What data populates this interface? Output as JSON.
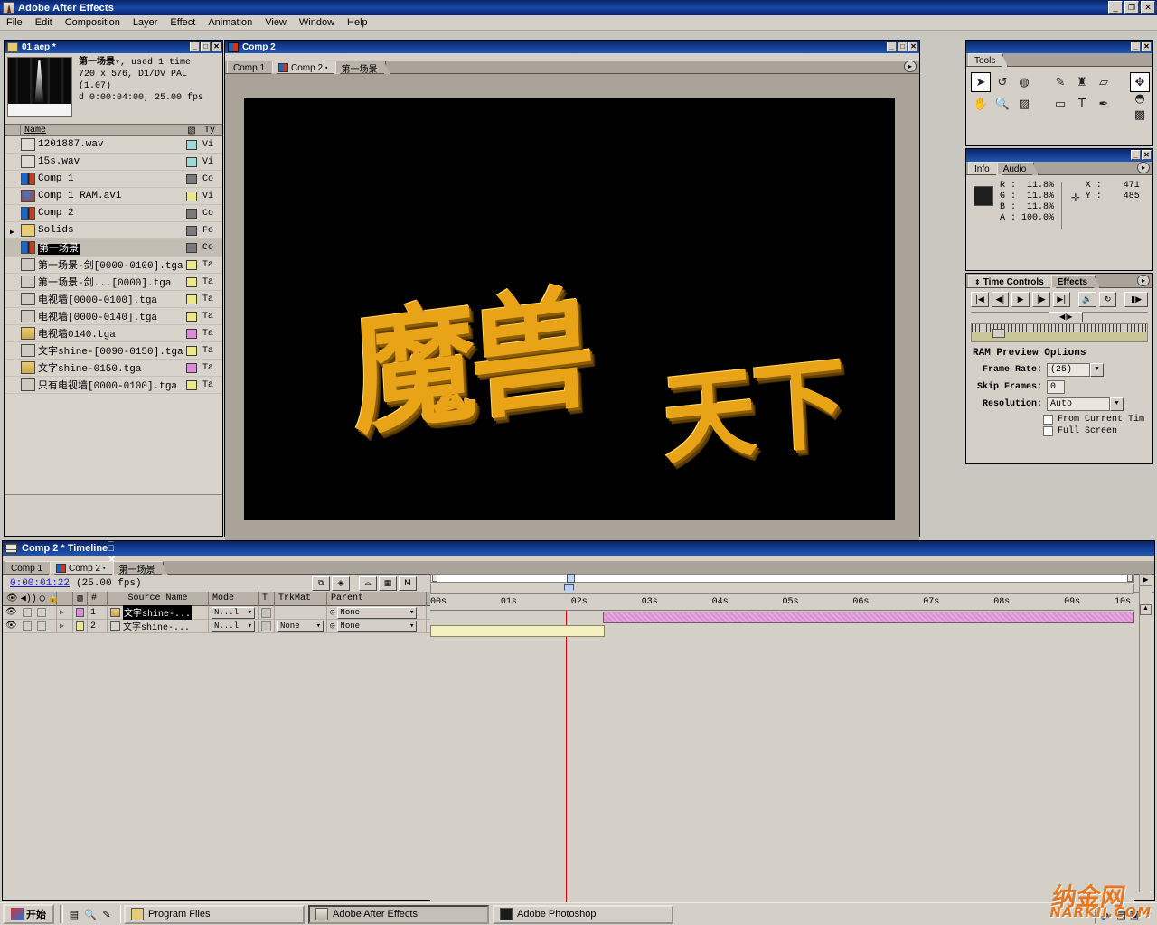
{
  "window": {
    "app_title": "Adobe After Effects",
    "minimize": "_",
    "restore": "❐",
    "close": "✕"
  },
  "menu": {
    "items": [
      "File",
      "Edit",
      "Composition",
      "Layer",
      "Effect",
      "Animation",
      "View",
      "Window",
      "Help"
    ]
  },
  "project": {
    "title": "01.aep *",
    "minimize": "_",
    "maximize": "□",
    "close": "✕",
    "preview": {
      "name": "第一场景",
      "dropdown": "▾",
      "used": ", used 1 time",
      "dimensions": "720 x 576, D1/DV PAL (1.07)",
      "duration": "d 0:00:04:00, 25.00 fps"
    },
    "columns": {
      "name": "Name",
      "type": "Ty"
    },
    "items": [
      {
        "name": "1201887.wav",
        "icon": "audio-icon",
        "swatch": "#9fd8d8",
        "type": "Vi"
      },
      {
        "name": "15s.wav",
        "icon": "audio-icon",
        "swatch": "#9fd8d8",
        "type": "Vi"
      },
      {
        "name": "Comp 1",
        "icon": "comp-icon",
        "swatch": "#7a7a7a",
        "type": "Co"
      },
      {
        "name": "Comp 1 RAM.avi",
        "icon": "movie-icon",
        "swatch": "#ece98a",
        "type": "Vi"
      },
      {
        "name": "Comp 2",
        "icon": "comp-icon",
        "swatch": "#7a7a7a",
        "type": "Co"
      },
      {
        "name": "Solids",
        "icon": "folder-icon",
        "swatch": "#7a7a7a",
        "type": "Fo",
        "expandable": true
      },
      {
        "name": "第一场景",
        "icon": "comp-icon",
        "swatch": "#7a7a7a",
        "type": "Co",
        "selected": true
      },
      {
        "name": "第一场景-剑[0000-0100].tga",
        "icon": "seq-icon",
        "swatch": "#ece98a",
        "type": "Ta"
      },
      {
        "name": "第一场景-剑...[0000].tga",
        "icon": "seq-icon",
        "swatch": "#ece98a",
        "type": "Ta"
      },
      {
        "name": "电视墙[0000-0100].tga",
        "icon": "seq-icon",
        "swatch": "#ece98a",
        "type": "Ta"
      },
      {
        "name": "电视墙[0000-0140].tga",
        "icon": "seq-icon",
        "swatch": "#ece98a",
        "type": "Ta"
      },
      {
        "name": "电视墙0140.tga",
        "icon": "still-icon",
        "swatch": "#dd8ad8",
        "type": "Ta"
      },
      {
        "name": "文字shine-[0090-0150].tga",
        "icon": "seq-icon",
        "swatch": "#ece98a",
        "type": "Ta"
      },
      {
        "name": "文字shine-0150.tga",
        "icon": "still-icon",
        "swatch": "#dd8ad8",
        "type": "Ta"
      },
      {
        "name": "只有电视墙[0000-0100].tga",
        "icon": "seq-icon",
        "swatch": "#ece98a",
        "type": "Ta"
      }
    ]
  },
  "comp_window": {
    "title": "Comp 2",
    "minimize": "_",
    "maximize": "□",
    "close": "✕",
    "tabs": [
      {
        "label": "Comp 1",
        "active": false
      },
      {
        "label": "Comp 2",
        "active": true
      },
      {
        "label": "第一场景",
        "active": false
      }
    ],
    "menu_arrow": "▸",
    "artwork": {
      "background": "#000000",
      "gold": "#e8a317",
      "text_left": "魔兽",
      "text_right": "天下"
    }
  },
  "tools": {
    "title": "Tools",
    "minimize": "_",
    "close": "✕",
    "items": [
      {
        "name": "selection-tool",
        "glyph": "➤",
        "active": true
      },
      {
        "name": "rotate-tool",
        "glyph": "↺",
        "active": false
      },
      {
        "name": "orbit-tool",
        "glyph": "◍",
        "active": false
      },
      {
        "name": "hand-tool",
        "glyph": "✋",
        "active": false
      },
      {
        "name": "zoom-tool",
        "glyph": "🔍",
        "active": false
      },
      {
        "name": "mask-tool",
        "glyph": "▨",
        "active": false
      },
      {
        "name": "brush-tool",
        "glyph": "✎",
        "active": false
      },
      {
        "name": "clone-stamp-tool",
        "glyph": "♜",
        "active": false
      },
      {
        "name": "eraser-tool",
        "glyph": "▱",
        "active": false
      },
      {
        "name": "shape-tool",
        "glyph": "▭",
        "active": false
      },
      {
        "name": "text-tool",
        "glyph": "T",
        "active": false
      },
      {
        "name": "pen-tool",
        "glyph": "✒",
        "active": false
      },
      {
        "name": "axis-tool",
        "glyph": "✥",
        "active": true
      },
      {
        "name": "light-tool",
        "glyph": "◓",
        "active": false
      },
      {
        "name": "camera-tool",
        "glyph": "▩",
        "active": false
      }
    ]
  },
  "info": {
    "minimize": "_",
    "close": "✕",
    "tabs": [
      {
        "label": "Info",
        "active": true
      },
      {
        "label": "Audio",
        "active": false
      }
    ],
    "menu_arrow": "▸",
    "swatch_color": "#1e1e1e",
    "channels": [
      {
        "label": "R :",
        "value": "11.8%"
      },
      {
        "label": "G :",
        "value": "11.8%"
      },
      {
        "label": "B :",
        "value": "11.8%"
      },
      {
        "label": "A :",
        "value": "100.0%"
      }
    ],
    "coords": [
      {
        "label": "X :",
        "value": "471"
      },
      {
        "label": "Y :",
        "value": "485"
      }
    ]
  },
  "time_controls": {
    "menu_arrow": "▸",
    "tabs": [
      {
        "label": "Time Controls",
        "active": true
      },
      {
        "label": "Effects",
        "active": false
      }
    ],
    "transport": [
      {
        "name": "first-frame-button",
        "glyph": "|◀"
      },
      {
        "name": "previous-frame-button",
        "glyph": "◀|"
      },
      {
        "name": "play-button",
        "glyph": "▶"
      },
      {
        "name": "next-frame-button",
        "glyph": "|▶"
      },
      {
        "name": "last-frame-button",
        "glyph": "▶|"
      },
      {
        "name": "audio-toggle-button",
        "glyph": "🔊"
      },
      {
        "name": "loop-button",
        "glyph": "↻"
      },
      {
        "name": "ram-preview-button",
        "glyph": "▮▶"
      }
    ],
    "shuttle_label": "◀|▶",
    "options_title": "RAM Preview Options",
    "frame_rate_label": "Frame Rate:",
    "frame_rate_value": "(25)",
    "skip_frames_label": "Skip Frames:",
    "skip_frames_value": "0",
    "resolution_label": "Resolution:",
    "resolution_value": "Auto",
    "from_current_time_label": "From Current Tim",
    "from_current_time_checked": false,
    "full_screen_label": "Full Screen",
    "full_screen_checked": false,
    "dropdown_arrow": "▼"
  },
  "timeline": {
    "title": "Comp 2 * Timeline",
    "minimize": "_",
    "maximize": "□",
    "close": "✕",
    "tabs": [
      {
        "label": "Comp 1",
        "active": false
      },
      {
        "label": "Comp 2",
        "active": true
      },
      {
        "label": "第一场景",
        "active": false
      }
    ],
    "current_time": "0:00:01:22",
    "fps_label": "(25.00 fps)",
    "toolbar_buttons": [
      {
        "name": "layer-switches-button",
        "glyph": "⧉"
      },
      {
        "name": "transfer-controls-button",
        "glyph": "◈"
      },
      {
        "name": "shy-layers-button",
        "glyph": "⌓"
      },
      {
        "name": "frame-blending-button",
        "glyph": "▦"
      },
      {
        "name": "motion-blur-button",
        "glyph": "M"
      }
    ],
    "columns": {
      "av_features": "👁 🔊 ◯ 🔒",
      "label": "▧",
      "number": "#",
      "source_name": "Source Name",
      "mode": "Mode",
      "t": "T",
      "trkmat": "TrkMat",
      "parent": "Parent"
    },
    "layers": [
      {
        "index": "1",
        "source_name": "文字shine-...",
        "swatch": "#dd8ad8",
        "mode": "N...l",
        "trkmat": "",
        "parent": "None",
        "selected": true,
        "bar_color": "#d98fd0",
        "bar_start_pct": 24.5,
        "bar_end_pct": 100
      },
      {
        "index": "2",
        "source_name": "文字shine-...",
        "swatch": "#ece98a",
        "mode": "N...l",
        "trkmat": "None",
        "parent": "None",
        "selected": false,
        "bar_color": "#f5f0c0",
        "bar_start_pct": 0,
        "bar_end_pct": 24.8
      }
    ],
    "ruler_ticks": [
      "00s",
      "01s",
      "02s",
      "03s",
      "04s",
      "05s",
      "06s",
      "07s",
      "08s",
      "09s",
      "10s"
    ],
    "cti_pct": 19.3,
    "scroll_right_arrow": "▶"
  },
  "taskbar": {
    "start_label": "开始",
    "quicklaunch": [
      {
        "name": "show-desktop-icon",
        "glyph": "▤"
      },
      {
        "name": "ie-icon",
        "glyph": "🔍"
      },
      {
        "name": "media-icon",
        "glyph": "✎"
      }
    ],
    "items": [
      {
        "label": "Program Files",
        "icon": "folder-icon",
        "active": false
      },
      {
        "label": "Adobe After Effects",
        "icon": "ae-icon",
        "active": true
      },
      {
        "label": "Adobe Photoshop",
        "icon": "ps-icon",
        "active": false
      }
    ],
    "tray": [
      {
        "name": "volume-icon",
        "glyph": "🔈"
      },
      {
        "name": "network-icon",
        "glyph": "▤"
      },
      {
        "name": "display-icon",
        "glyph": "▣"
      },
      {
        "name": "antivirus-icon",
        "glyph": "☂"
      }
    ]
  },
  "watermark": {
    "text": "纳金网",
    "sub": "NARKII.COM"
  }
}
